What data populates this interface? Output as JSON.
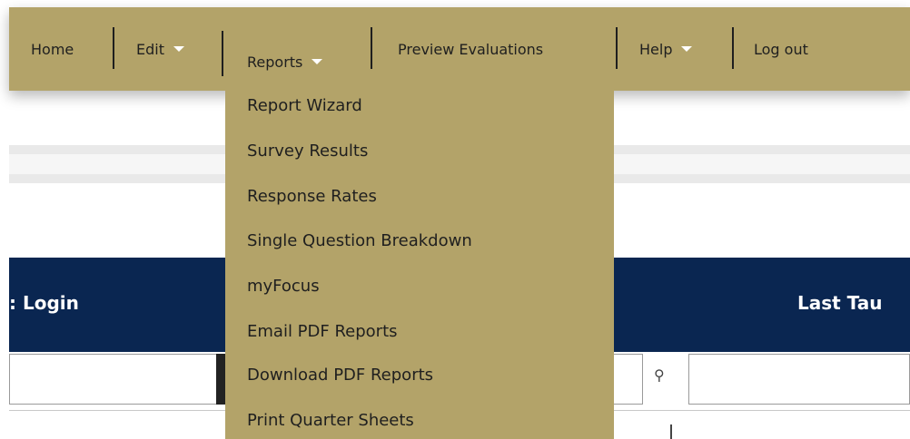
{
  "nav": {
    "home": "Home",
    "edit": "Edit",
    "reports": "Reports",
    "preview": "Preview Evaluations",
    "help": "Help",
    "logout": "Log out"
  },
  "reports_menu": {
    "items": [
      "Report Wizard",
      "Survey Results",
      "Response Rates",
      "Single Question Breakdown",
      "myFocus",
      "Email PDF Reports",
      "Download PDF Reports",
      "Print Quarter Sheets"
    ]
  },
  "table": {
    "col_login": ": Login",
    "col_last": "Last Tau"
  },
  "colors": {
    "nav_bg": "#b3a369",
    "header_bg": "#0a2651",
    "caret": "#ffffff"
  }
}
